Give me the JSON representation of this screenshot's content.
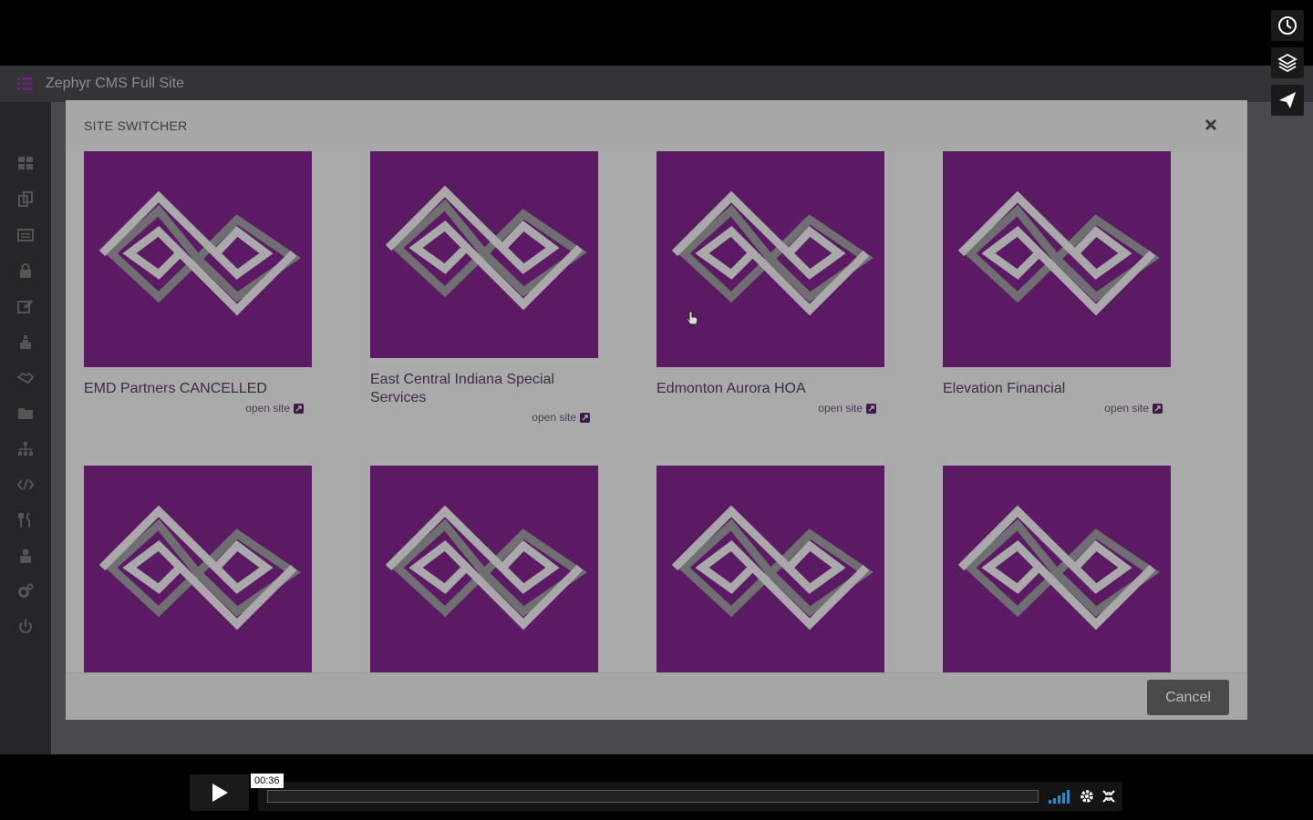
{
  "app": {
    "title": "Zephyr CMS Full Site"
  },
  "sidebar": {
    "icons": [
      "dashboard-icon",
      "copy-icon",
      "list-icon",
      "lock-icon",
      "edit-icon",
      "sitemap-icon",
      "handshake-icon",
      "folder-icon",
      "network-icon",
      "code-icon",
      "utensils-icon",
      "user-lock-icon",
      "cogs-icon",
      "power-icon"
    ]
  },
  "modal": {
    "title": "SITE SWITCHER",
    "cancel_label": "Cancel",
    "sites": [
      {
        "name": "EMD Partners CANCELLED",
        "link": "open site"
      },
      {
        "name": "East Central Indiana Special Services",
        "link": "open site"
      },
      {
        "name": "Edmonton Aurora HOA",
        "link": "open site"
      },
      {
        "name": "Elevation Financial",
        "link": "open site"
      },
      {
        "name": "",
        "link": ""
      },
      {
        "name": "",
        "link": ""
      },
      {
        "name": "",
        "link": ""
      },
      {
        "name": "",
        "link": ""
      }
    ]
  },
  "overlay_buttons": [
    "clock-icon",
    "layers-icon",
    "send-icon"
  ],
  "player": {
    "timecode": "00:36"
  },
  "colors": {
    "tile": "#7b1f83",
    "accent": "#7b2c87"
  }
}
